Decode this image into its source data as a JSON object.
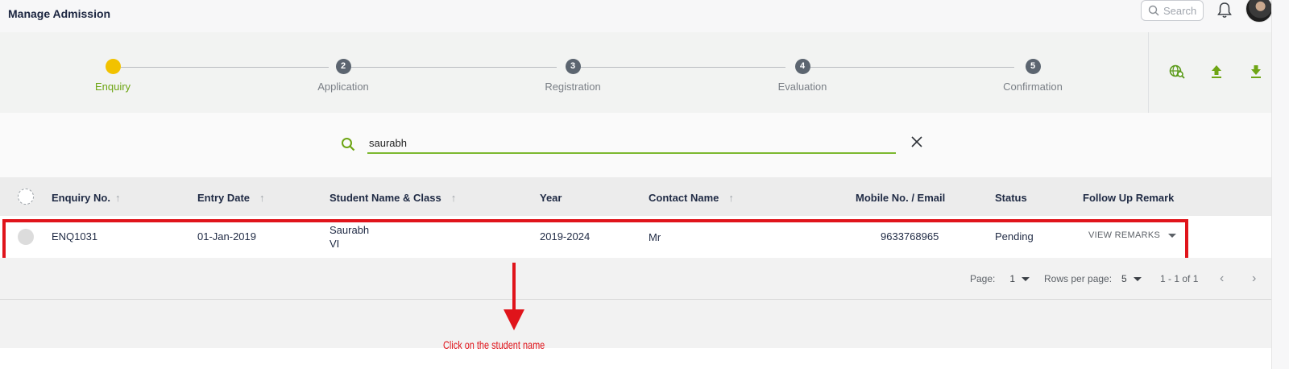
{
  "header": {
    "title": "Manage Admission",
    "search_placeholder": "Search",
    "icons": [
      "search-icon",
      "bell-icon",
      "avatar"
    ]
  },
  "stepper": {
    "steps": [
      {
        "number": "1",
        "label": "Enquiry",
        "active": true
      },
      {
        "number": "2",
        "label": "Application",
        "active": false
      },
      {
        "number": "3",
        "label": "Registration",
        "active": false
      },
      {
        "number": "4",
        "label": "Evaluation",
        "active": false
      },
      {
        "number": "5",
        "label": "Confirmation",
        "active": false
      }
    ],
    "tools": [
      "globe-search-icon",
      "upload-icon",
      "download-icon"
    ]
  },
  "filter": {
    "value": "saurabh"
  },
  "table": {
    "columns": [
      {
        "label": "Enquiry No.",
        "sortable": true
      },
      {
        "label": "Entry Date",
        "sortable": true
      },
      {
        "label": "Student Name & Class",
        "sortable": true
      },
      {
        "label": "Year",
        "sortable": false
      },
      {
        "label": "Contact Name",
        "sortable": true
      },
      {
        "label": "Mobile No. / Email",
        "sortable": false
      },
      {
        "label": "Status",
        "sortable": false
      },
      {
        "label": "Follow Up Remark",
        "sortable": false
      }
    ],
    "rows": [
      {
        "enquiry_no": "ENQ1031",
        "entry_date": "01-Jan-2019",
        "student_name": "Saurabh",
        "student_class": "VI",
        "year": "2019-2024",
        "contact_name": "Mr",
        "mobile": "9633768965",
        "status": "Pending",
        "remark_button": "VIEW REMARKS"
      }
    ]
  },
  "pagination": {
    "page_label": "Page:",
    "page_value": "1",
    "rows_label": "Rows per page:",
    "rows_value": "5",
    "range": "1 - 1 of 1"
  },
  "annotation": {
    "text": "Click on the student name",
    "color": "#e0141b"
  },
  "colors": {
    "accent_green": "#7cb82f",
    "active_step": "#f2c200",
    "step_inactive": "#5c6570"
  }
}
